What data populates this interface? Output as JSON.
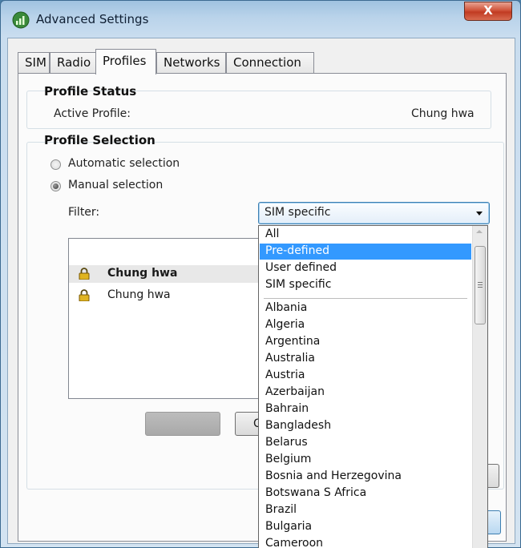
{
  "window": {
    "title": "Advanced Settings",
    "close_label": "X"
  },
  "tabs": [
    {
      "label": "SIM"
    },
    {
      "label": "Radio"
    },
    {
      "label": "Profiles"
    },
    {
      "label": "Networks"
    },
    {
      "label": "Connection"
    }
  ],
  "active_tab": "Profiles",
  "profile_status": {
    "heading": "Profile Status",
    "active_label": "Active Profile:",
    "active_value": "Chung hwa"
  },
  "profile_selection": {
    "heading": "Profile Selection",
    "automatic_label": "Automatic selection",
    "manual_label": "Manual selection",
    "selected_mode": "manual",
    "filter_label": "Filter:",
    "filter_value": "SIM specific"
  },
  "profile_list": [
    {
      "name": "Chung hwa",
      "icon": "lock-icon",
      "selected": true
    },
    {
      "name": "Chung hwa",
      "icon": "lock-icon",
      "selected": false
    }
  ],
  "buttons": {
    "partial_label": "C"
  },
  "dropdown": {
    "group1": [
      "All",
      "Pre-defined",
      "User defined",
      "SIM specific"
    ],
    "highlighted": "Pre-defined",
    "countries": [
      "Albania",
      "Algeria",
      "Argentina",
      "Australia",
      "Austria",
      "Azerbaijan",
      "Bahrain",
      "Bangladesh",
      "Belarus",
      "Belgium",
      "Bosnia and Herzegovina",
      "Botswana S Africa",
      "Brazil",
      "Bulgaria",
      "Cameroon"
    ]
  },
  "colors": {
    "highlight": "#3399ff",
    "title_bar": "#b9d3ea",
    "close_button": "#c13b22"
  }
}
